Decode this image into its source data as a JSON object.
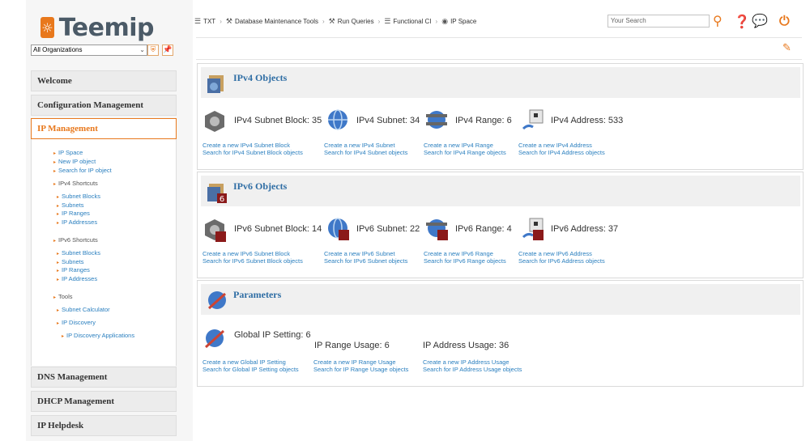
{
  "brand": {
    "name": "Teemip"
  },
  "org_select": {
    "value": "All Organizations"
  },
  "search": {
    "placeholder": "Your Search"
  },
  "breadcrumb": [
    "TXT",
    "Database Maintenance Tools",
    "Run Queries",
    "Functional CI",
    "IP Space"
  ],
  "menu": {
    "welcome": "Welcome",
    "config": "Configuration Management",
    "ipm": "IP Management",
    "dns": "DNS Management",
    "dhcp": "DHCP Management",
    "helpdesk": "IP Helpdesk"
  },
  "ipm_items": {
    "ip_space": "IP Space",
    "new_ip": "New IP object",
    "search_ip": "Search for IP object",
    "v4_short": "IPv4 Shortcuts",
    "v4_blocks": "Subnet Blocks",
    "v4_subnets": "Subnets",
    "v4_ranges": "IP Ranges",
    "v4_addrs": "IP Addresses",
    "v6_short": "IPv6 Shortcuts",
    "v6_blocks": "Subnet Blocks",
    "v6_subnets": "Subnets",
    "v6_ranges": "IP Ranges",
    "v6_addrs": "IP Addresses",
    "tools": "Tools",
    "subnet_calc": "Subnet Calculator",
    "ip_disc": "IP Discovery",
    "ip_disc_apps": "IP Discovery Applications"
  },
  "ipv4": {
    "title": "IPv4 Objects",
    "block": {
      "label": "IPv4 Subnet Block: 35",
      "create": "Create a new IPv4 Subnet Block",
      "search": "Search for IPv4 Subnet Block objects"
    },
    "subnet": {
      "label": "IPv4 Subnet: 34",
      "create": "Create a new IPv4 Subnet",
      "search": "Search for IPv4 Subnet objects"
    },
    "range": {
      "label": "IPv4 Range: 6",
      "create": "Create a new IPv4 Range",
      "search": "Search for IPv4 Range objects"
    },
    "address": {
      "label": "IPv4 Address: 533",
      "create": "Create a new IPv4 Address",
      "search": "Search for IPv4 Address objects"
    }
  },
  "ipv6": {
    "title": "IPv6 Objects",
    "block": {
      "label": "IPv6 Subnet Block: 14",
      "create": "Create a new IPv6 Subnet Block",
      "search": "Search for IPv6 Subnet Block objects"
    },
    "subnet": {
      "label": "IPv6 Subnet: 22",
      "create": "Create a new IPv6 Subnet",
      "search": "Search for IPv6 Subnet objects"
    },
    "range": {
      "label": "IPv6 Range: 4",
      "create": "Create a new IPv6 Range",
      "search": "Search for IPv6 Range objects"
    },
    "address": {
      "label": "IPv6 Address: 37",
      "create": "Create a new IPv6 Address",
      "search": "Search for IPv6 Address objects"
    }
  },
  "params": {
    "title": "Parameters",
    "global": {
      "label": "Global IP Setting: 6",
      "create": "Create a new Global IP Setting",
      "search": "Search for Global IP Setting objects"
    },
    "range_usage": {
      "label": "IP Range Usage: 6",
      "create": "Create a new IP Range Usage",
      "search": "Search for IP Range Usage objects"
    },
    "addr_usage": {
      "label": "IP Address Usage: 36",
      "create": "Create a new IP Address Usage",
      "search": "Search for IP Address Usage objects"
    }
  },
  "badge6": "6",
  "colors": {
    "accent": "#e8781c",
    "link": "#2a7fbf",
    "title": "#2e6da4"
  }
}
